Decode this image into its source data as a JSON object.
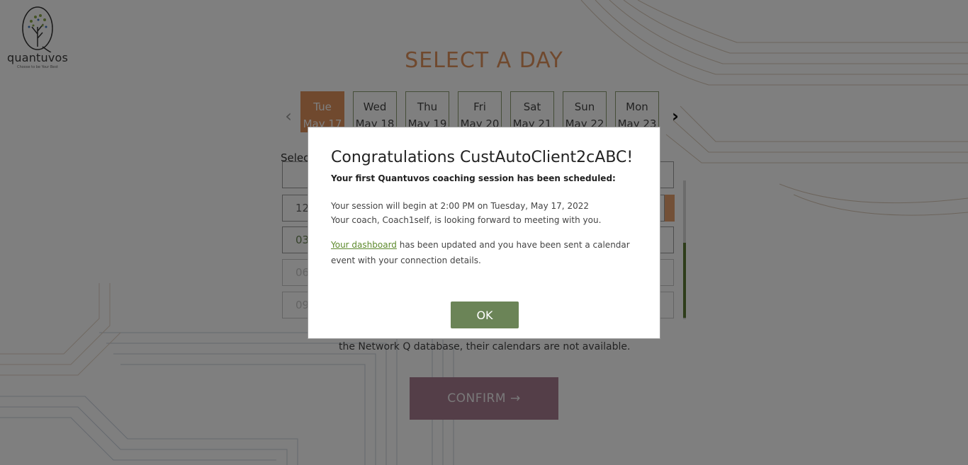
{
  "logo": {
    "name": "quantuvos",
    "tagline": "Choose to be Your Best"
  },
  "page": {
    "title": "SELECT A DAY"
  },
  "days": [
    {
      "day": "Tue",
      "date": "May 17",
      "selected": true
    },
    {
      "day": "Wed",
      "date": "May 18",
      "selected": false
    },
    {
      "day": "Thu",
      "date": "May 19",
      "selected": false
    },
    {
      "day": "Fri",
      "date": "May 20",
      "selected": false
    },
    {
      "day": "Sat",
      "date": "May 21",
      "selected": false
    },
    {
      "day": "Sun",
      "date": "May 22",
      "selected": false
    },
    {
      "day": "Mon",
      "date": "May 23",
      "selected": false
    }
  ],
  "time_section": {
    "label": "Selec",
    "slots": [
      "",
      "12",
      "03",
      "06",
      "09"
    ]
  },
  "network_note": "the Network Q database, their calendars are not available.",
  "confirm": {
    "label": "CONFIRM →"
  },
  "modal": {
    "title": "Congratulations CustAutoClient2cABC!",
    "subtitle": "Your first Quantuvos coaching session has been scheduled:",
    "line1": "Your session will begin at 2:00 PM on Tuesday, May 17, 2022",
    "line2": "Your coach, Coach1self, is looking forward to meeting with you.",
    "link_text": "Your dashboard",
    "line3_rest": " has been updated and you have been sent a calendar event with your connection details.",
    "ok_label": "OK"
  },
  "colors": {
    "accent_orange": "#e0925c",
    "ok_green": "#6b8457",
    "link_green": "#5d8a2c",
    "confirm_purple": "#a97c90"
  }
}
